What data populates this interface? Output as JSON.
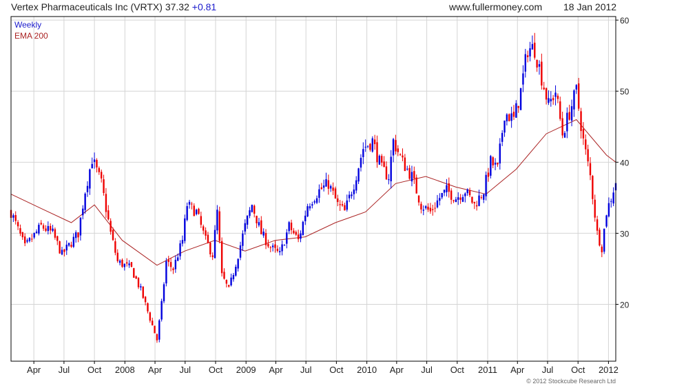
{
  "header": {
    "title": "Vertex Pharmaceuticals Inc (VRTX)",
    "price": "37.32",
    "change": "+0.81",
    "site": "www.fullermoney.com",
    "date": "18 Jan 2012"
  },
  "legend": {
    "weekly": "Weekly",
    "ema": "EMA 200"
  },
  "copyright": "© 2012 Stockcube Research Ltd",
  "colors": {
    "up": "#0000dd",
    "down": "#ee0000",
    "ema": "#aa2222",
    "grid": "#d4d4d4",
    "frame": "#000000"
  },
  "chart_data": {
    "type": "candlestick",
    "interval": "Weekly",
    "ylim": [
      12,
      60.5
    ],
    "yticks": [
      20,
      30,
      40,
      50,
      60
    ],
    "x_start": "2007-01-22",
    "x_end": "2012-01-23",
    "xticks": [
      {
        "label": "Apr",
        "date": "2007-04-01"
      },
      {
        "label": "Jul",
        "date": "2007-07-01"
      },
      {
        "label": "Oct",
        "date": "2007-10-01"
      },
      {
        "label": "2008",
        "date": "2008-01-01"
      },
      {
        "label": "Apr",
        "date": "2008-04-01"
      },
      {
        "label": "Jul",
        "date": "2008-07-01"
      },
      {
        "label": "Oct",
        "date": "2008-10-01"
      },
      {
        "label": "2009",
        "date": "2009-01-01"
      },
      {
        "label": "Apr",
        "date": "2009-04-01"
      },
      {
        "label": "Jul",
        "date": "2009-07-01"
      },
      {
        "label": "Oct",
        "date": "2009-10-01"
      },
      {
        "label": "2010",
        "date": "2010-01-01"
      },
      {
        "label": "Apr",
        "date": "2010-04-01"
      },
      {
        "label": "Jul",
        "date": "2010-07-01"
      },
      {
        "label": "Oct",
        "date": "2010-10-01"
      },
      {
        "label": "2011",
        "date": "2011-01-01"
      },
      {
        "label": "Apr",
        "date": "2011-04-01"
      },
      {
        "label": "Jul",
        "date": "2011-07-01"
      },
      {
        "label": "Oct",
        "date": "2011-10-01"
      },
      {
        "label": "2012",
        "date": "2012-01-01"
      }
    ],
    "price_path": [
      [
        "2007-01-22",
        33
      ],
      [
        "2007-03-05",
        28
      ],
      [
        "2007-04-23",
        31
      ],
      [
        "2007-05-28",
        30
      ],
      [
        "2007-06-25",
        27
      ],
      [
        "2007-08-13",
        30
      ],
      [
        "2007-09-03",
        36
      ],
      [
        "2007-09-24",
        40.5
      ],
      [
        "2007-10-22",
        37
      ],
      [
        "2007-11-19",
        30
      ],
      [
        "2007-12-10",
        26
      ],
      [
        "2008-01-21",
        25
      ],
      [
        "2008-02-18",
        22
      ],
      [
        "2008-03-17",
        18
      ],
      [
        "2008-04-07",
        15
      ],
      [
        "2008-04-21",
        20
      ],
      [
        "2008-05-05",
        26
      ],
      [
        "2008-05-26",
        25
      ],
      [
        "2008-06-23",
        29
      ],
      [
        "2008-07-07",
        34
      ],
      [
        "2008-08-04",
        33
      ],
      [
        "2008-09-01",
        29
      ],
      [
        "2008-09-22",
        27
      ],
      [
        "2008-10-06",
        33
      ],
      [
        "2008-10-20",
        24
      ],
      [
        "2008-11-10",
        22
      ],
      [
        "2008-12-08",
        27
      ],
      [
        "2008-12-29",
        31
      ],
      [
        "2009-01-19",
        34
      ],
      [
        "2009-02-16",
        30
      ],
      [
        "2009-03-16",
        28
      ],
      [
        "2009-04-13",
        27
      ],
      [
        "2009-05-11",
        31
      ],
      [
        "2009-06-08",
        29
      ],
      [
        "2009-07-06",
        34
      ],
      [
        "2009-08-10",
        36
      ],
      [
        "2009-09-07",
        37
      ],
      [
        "2009-10-05",
        34
      ],
      [
        "2009-10-26",
        33
      ],
      [
        "2009-11-23",
        37
      ],
      [
        "2009-12-21",
        42
      ],
      [
        "2010-01-18",
        43
      ],
      [
        "2010-02-15",
        39
      ],
      [
        "2010-03-08",
        38
      ],
      [
        "2010-03-22",
        43
      ],
      [
        "2010-04-19",
        40
      ],
      [
        "2010-05-17",
        38
      ],
      [
        "2010-06-14",
        34
      ],
      [
        "2010-07-12",
        33
      ],
      [
        "2010-08-09",
        35
      ],
      [
        "2010-08-30",
        36
      ],
      [
        "2010-09-27",
        35
      ],
      [
        "2010-10-25",
        36
      ],
      [
        "2010-11-22",
        34
      ],
      [
        "2010-12-20",
        36
      ],
      [
        "2011-01-10",
        40
      ],
      [
        "2011-01-31",
        39
      ],
      [
        "2011-02-21",
        47
      ],
      [
        "2011-03-21",
        46
      ],
      [
        "2011-04-11",
        50
      ],
      [
        "2011-05-02",
        56
      ],
      [
        "2011-05-23",
        56
      ],
      [
        "2011-06-13",
        52
      ],
      [
        "2011-07-04",
        48
      ],
      [
        "2011-07-25",
        50
      ],
      [
        "2011-08-15",
        44
      ],
      [
        "2011-09-05",
        47
      ],
      [
        "2011-09-26",
        50
      ],
      [
        "2011-10-17",
        43
      ],
      [
        "2011-11-07",
        38
      ],
      [
        "2011-11-28",
        30
      ],
      [
        "2011-12-12",
        28
      ],
      [
        "2011-12-26",
        33
      ],
      [
        "2012-01-09",
        35
      ],
      [
        "2012-01-23",
        37.3
      ]
    ],
    "ema_200": [
      [
        "2007-01-22",
        35.5
      ],
      [
        "2007-04-23",
        33.5
      ],
      [
        "2007-07-23",
        31.5
      ],
      [
        "2007-10-01",
        34
      ],
      [
        "2007-12-24",
        29
      ],
      [
        "2008-04-07",
        25.5
      ],
      [
        "2008-06-30",
        27.5
      ],
      [
        "2008-09-29",
        29
      ],
      [
        "2008-12-29",
        27.5
      ],
      [
        "2009-03-30",
        29
      ],
      [
        "2009-06-29",
        29.5
      ],
      [
        "2009-09-28",
        31.5
      ],
      [
        "2009-12-28",
        33
      ],
      [
        "2010-03-29",
        37
      ],
      [
        "2010-06-28",
        38
      ],
      [
        "2010-09-27",
        36.5
      ],
      [
        "2010-12-27",
        35.5
      ],
      [
        "2011-03-28",
        39
      ],
      [
        "2011-06-27",
        44
      ],
      [
        "2011-09-26",
        46
      ],
      [
        "2011-12-26",
        41
      ],
      [
        "2012-01-23",
        40
      ]
    ]
  }
}
